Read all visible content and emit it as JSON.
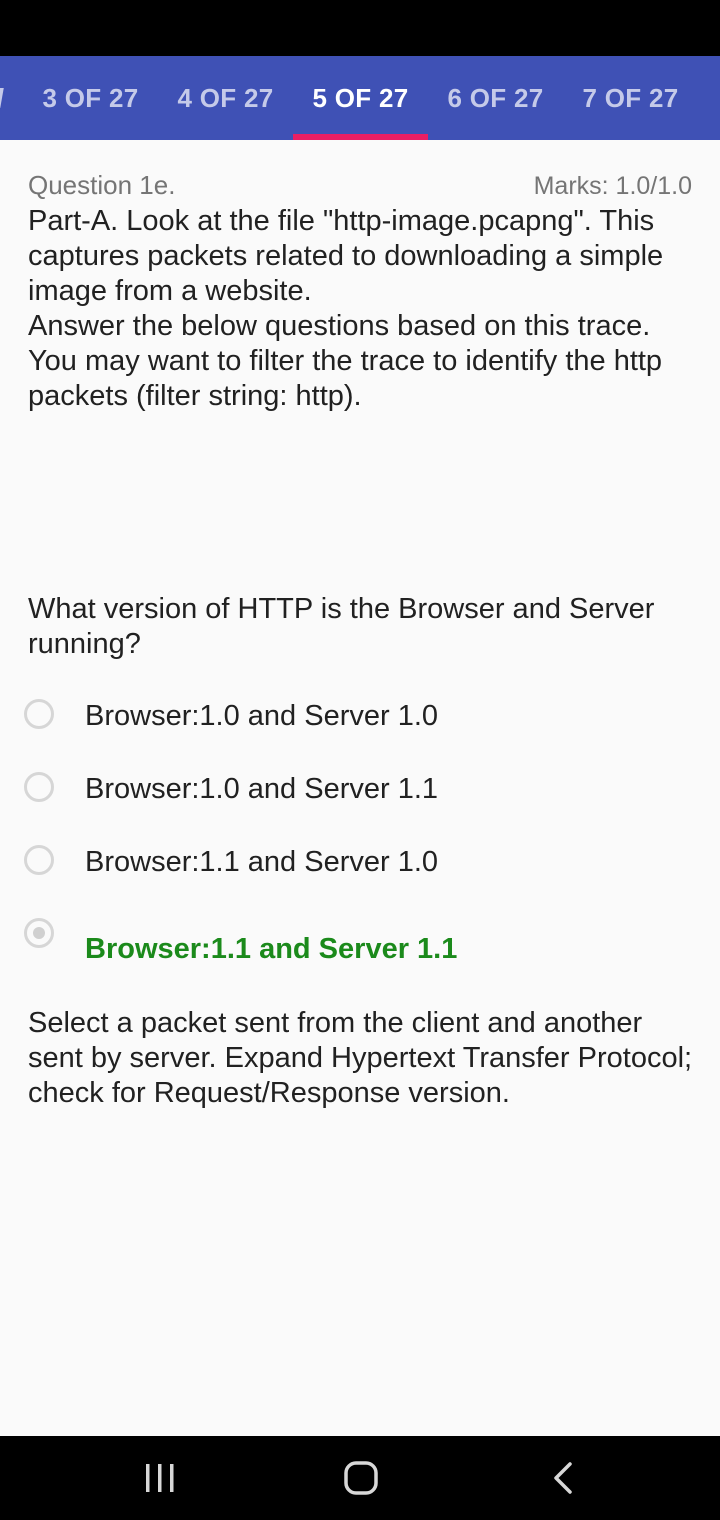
{
  "tabs": [
    {
      "label": "3 OF 27"
    },
    {
      "label": "4 OF 27"
    },
    {
      "label": "5 OF 27"
    },
    {
      "label": "6 OF 27"
    },
    {
      "label": "7 OF 27"
    }
  ],
  "question": {
    "label": "Question 1e.",
    "marks": "Marks: 1.0/1.0",
    "body_line1": "Part-A. Look at the file \"http-image.pcapng\". This captures packets related to downloading a simple image from a website.",
    "body_line2": "Answer the below questions based on this trace. You may want to filter the trace to identify the http packets (filter string: http).",
    "prompt": "What version of HTTP is the Browser and Server running?",
    "options": [
      {
        "label": "Browser:1.0 and Server 1.0"
      },
      {
        "label": "Browser:1.0 and Server 1.1"
      },
      {
        "label": "Browser:1.1 and Server 1.0"
      },
      {
        "label": "Browser:1.1 and Server 1.1"
      }
    ],
    "feedback": "Select a packet sent from the client and another sent by server. Expand Hypertext Transfer Protocol; check for Request/Response version."
  },
  "selected_option": 3,
  "colors": {
    "tab_bar": "#3f51b5",
    "tab_indicator": "#e91e63",
    "correct_answer": "#1b8a1b"
  },
  "icons": {
    "nav_recent": "recent-apps-icon",
    "nav_home": "home-icon",
    "nav_back": "back-icon"
  }
}
